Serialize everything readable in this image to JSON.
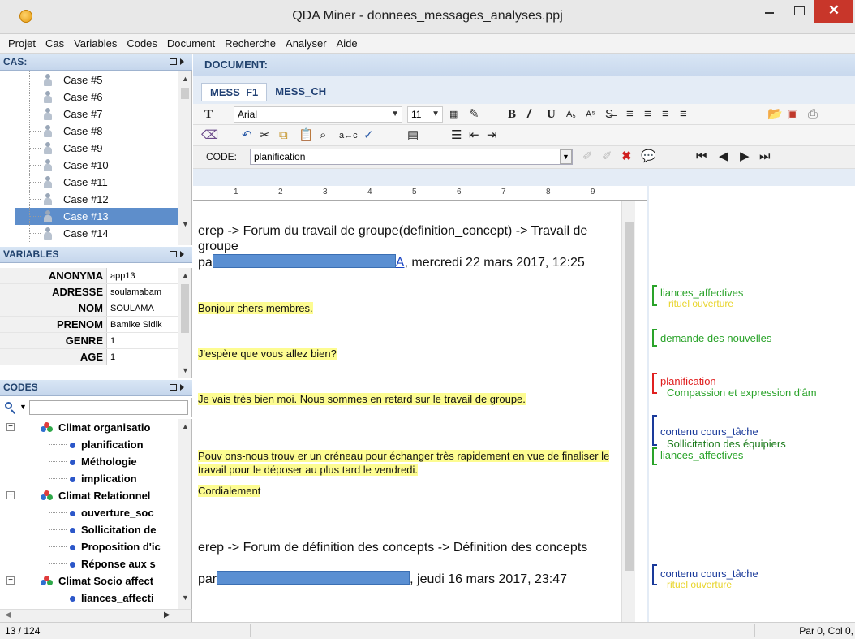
{
  "window": {
    "title": "QDA Miner - donnees_messages_analyses.ppj",
    "close_glyph": "✕"
  },
  "menu": [
    "Projet",
    "Cas",
    "Variables",
    "Codes",
    "Document",
    "Recherche",
    "Analyser",
    "Aide"
  ],
  "cases": {
    "header": "CAS:",
    "items": [
      "Case #5",
      "Case #6",
      "Case #7",
      "Case #8",
      "Case #9",
      "Case #10",
      "Case #11",
      "Case #12",
      "Case #13",
      "Case #14"
    ],
    "selected": "Case #13"
  },
  "variables": {
    "header": "VARIABLES",
    "rows": [
      {
        "name": "ANONYMA",
        "value": "app13"
      },
      {
        "name": "ADRESSE",
        "value": "soulamabam"
      },
      {
        "name": "NOM",
        "value": "SOULAMA"
      },
      {
        "name": "PRENOM",
        "value": "Bamike Sidik"
      },
      {
        "name": "GENRE",
        "value": "1"
      },
      {
        "name": "AGE",
        "value": "1"
      }
    ]
  },
  "codes": {
    "header": "CODES",
    "search_value": "",
    "tree": [
      {
        "label": "Climat organisatio",
        "kind": "cat"
      },
      {
        "label": "planification",
        "kind": "leaf"
      },
      {
        "label": "Méthologie",
        "kind": "leaf"
      },
      {
        "label": "implication",
        "kind": "leaf"
      },
      {
        "label": "Climat Relationnel",
        "kind": "cat"
      },
      {
        "label": "ouverture_soc",
        "kind": "leaf"
      },
      {
        "label": "Sollicitation de",
        "kind": "leaf"
      },
      {
        "label": "Proposition d'ic",
        "kind": "leaf"
      },
      {
        "label": "Réponse aux s",
        "kind": "leaf"
      },
      {
        "label": "Climat Socio affect",
        "kind": "cat"
      },
      {
        "label": "liances_affecti",
        "kind": "leaf"
      }
    ]
  },
  "document": {
    "header": "DOCUMENT:",
    "tabs": [
      "MESS_F1",
      "MESS_CH"
    ],
    "active_tab": "MESS_F1",
    "font": "Arial",
    "font_size": "11",
    "code_label": "CODE:",
    "code_value": "planification",
    "ruler": [
      "1",
      "2",
      "3",
      "4",
      "5",
      "6",
      "7",
      "8",
      "9"
    ],
    "paragraphs": {
      "p1": "erep -> Forum du travail de groupe(definition_concept) -> Travail de groupe",
      "p1_by": "pa",
      "p1_link": "A",
      "p1_date": ", mercredi 22 mars 2017, 12:25",
      "p2": "Bonjour chers membres.",
      "p3": "J'espère que vous allez bien?",
      "p4": "Je vais très bien moi. Nous sommes en retard sur le travail de groupe.",
      "p5": "Pouv ons-nous trouv er un créneau pour échanger très rapidement en vue de finaliser le travail pour le déposer au plus tard le vendredi.",
      "p6": "Cordialement",
      "p7": "erep -> Forum de définition des concepts -> Définition des concepts",
      "p7_by": "par",
      "p7_date": ", jeudi 16 mars 2017, 23:47"
    },
    "margin_codes": [
      {
        "label": "liances_affectives",
        "color": "#2aa32a"
      },
      {
        "label": "rituel ouverture",
        "color": "#e8d42a"
      },
      {
        "label": "demande des nouvelles",
        "color": "#2aa32a"
      },
      {
        "label": "planification",
        "color": "#e02020"
      },
      {
        "label": "Compassion et expression d'âm",
        "color": "#2aa32a"
      },
      {
        "label": "contenu cours_tâche",
        "color": "#1a3a9a"
      },
      {
        "label": "Sollicitation des équipiers",
        "color": "#1a7a1a"
      },
      {
        "label": "liances_affectives",
        "color": "#2aa32a"
      },
      {
        "label": "contenu cours_tâche",
        "color": "#1a3a9a"
      },
      {
        "label": "rituel ouverture",
        "color": "#e8d42a"
      }
    ]
  },
  "status": {
    "position": "13 / 124",
    "cursor": "Par 0, Col 0,"
  }
}
